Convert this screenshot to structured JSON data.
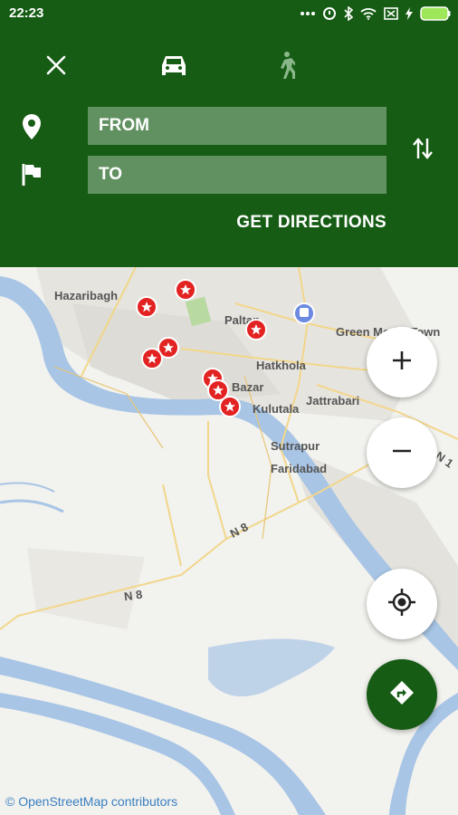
{
  "status_bar": {
    "time": "22:23",
    "icons": [
      "dots-icon",
      "sync-icon",
      "bluetooth-icon",
      "wifi-icon",
      "sim-icon",
      "charging-icon",
      "battery-icon"
    ]
  },
  "header": {
    "modes": [
      {
        "name": "close-icon",
        "active": true
      },
      {
        "name": "car-icon",
        "active": true
      },
      {
        "name": "walk-icon",
        "active": false
      }
    ],
    "from_placeholder": "FROM",
    "to_placeholder": "TO",
    "get_directions_label": "GET DIRECTIONS",
    "swap_icon": "swap-vertical-icon"
  },
  "map": {
    "labels": [
      {
        "id": "hazaribagh",
        "text": "Hazaribagh"
      },
      {
        "id": "paltan",
        "text": "Paltan"
      },
      {
        "id": "green-model-town",
        "text": "Green Model Town"
      },
      {
        "id": "hatkhola",
        "text": "Hatkhola"
      },
      {
        "id": "bazar",
        "text": "Bazar"
      },
      {
        "id": "jattrabari",
        "text": "Jattrabari"
      },
      {
        "id": "kulutala",
        "text": "Kulutala"
      },
      {
        "id": "sutrapur",
        "text": "Sutrapur"
      },
      {
        "id": "faridabad",
        "text": "Faridabad"
      },
      {
        "id": "n8-upper",
        "text": "N 8"
      },
      {
        "id": "n8-lower",
        "text": "N 8"
      },
      {
        "id": "n1",
        "text": "N 1"
      }
    ],
    "attribution": "© OpenStreetMap contributors"
  },
  "controls": {
    "zoom_in_icon": "plus-icon",
    "zoom_out_icon": "minus-icon",
    "locate_icon": "crosshair-icon",
    "directions_icon": "directions-icon"
  },
  "colors": {
    "primary": "#165c14",
    "water": "#a8c5e6",
    "marker": "#e32222"
  }
}
